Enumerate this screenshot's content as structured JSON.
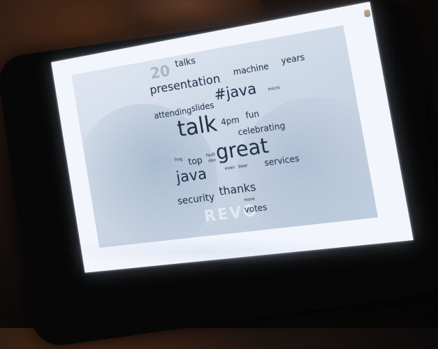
{
  "slide": {
    "faint_number": "20",
    "faint_logo_text": "REVO"
  },
  "word_cloud": {
    "words": [
      "talks",
      "presentation",
      "machine",
      "years",
      "#java",
      "micro",
      "attending",
      "slides",
      "talk",
      "4pm",
      "fun",
      "celebrating",
      "frog",
      "top",
      "fault",
      "dan",
      "great",
      "java",
      "even",
      "beer",
      "services",
      "security",
      "thanks",
      "more",
      "votes"
    ]
  },
  "colors": {
    "word": "#1f2f48",
    "screen": "#f2f5fb",
    "slide_bg": "#cdd8e6",
    "room_dark": "#0c0a09"
  }
}
